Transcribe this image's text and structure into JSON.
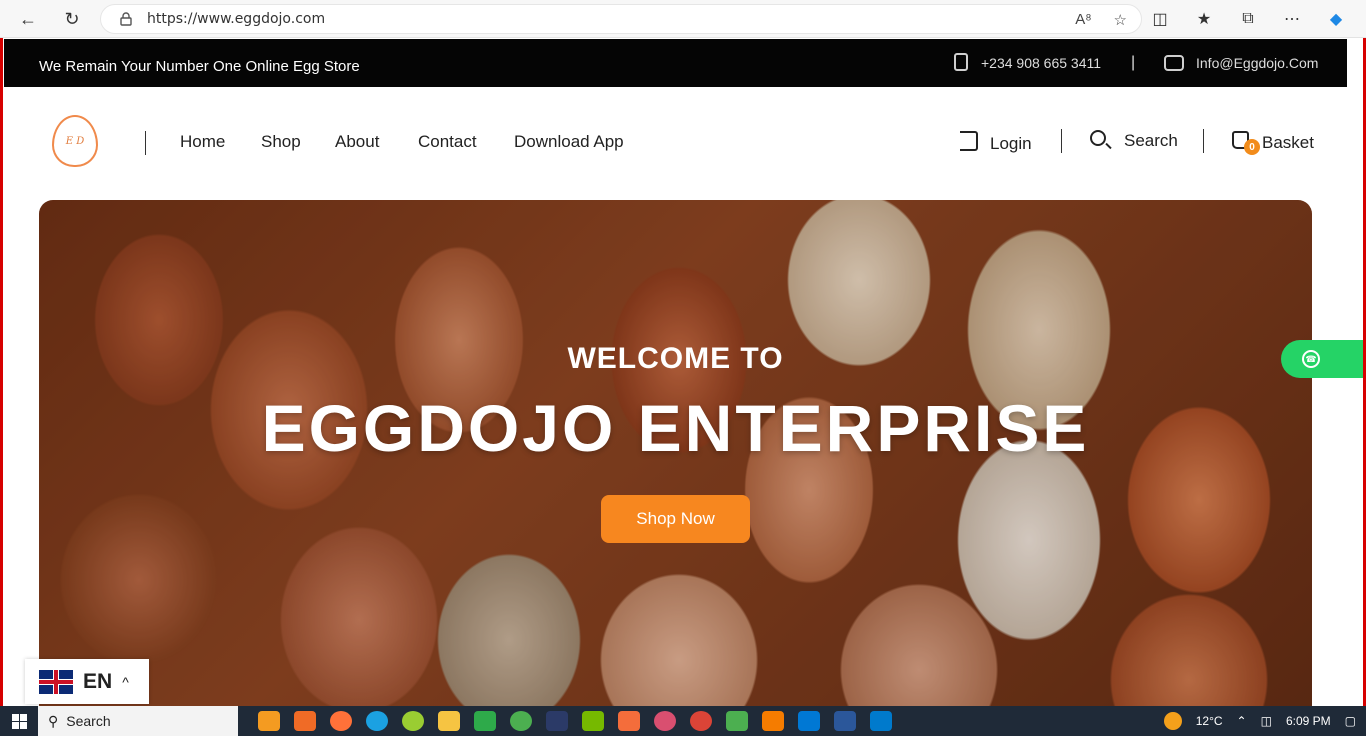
{
  "browser": {
    "url": "https://www.eggdojo.com",
    "icons": [
      "back-icon",
      "refresh-icon",
      "lock-icon",
      "read-aloud-icon",
      "favorite-icon",
      "split-screen-icon",
      "favorites-icon",
      "collections-icon",
      "more-icon",
      "copilot-icon"
    ]
  },
  "topbar": {
    "tagline": "We Remain Your Number One Online Egg Store",
    "phone": "+234 908 665 3411",
    "separator": "|",
    "email": "Info@Eggdojo.Com"
  },
  "logo": {
    "text": "E D"
  },
  "nav": {
    "items": [
      {
        "label": "Home"
      },
      {
        "label": "Shop"
      },
      {
        "label": "About"
      },
      {
        "label": "Contact"
      },
      {
        "label": "Download App"
      }
    ]
  },
  "actions": {
    "login": "Login",
    "search": "Search",
    "basket": "Basket",
    "basket_count": "0"
  },
  "hero": {
    "welcome": "WELCOME TO",
    "brand": "EGGDOJO ENTERPRISE",
    "cta": "Shop Now"
  },
  "language": {
    "code": "EN",
    "caret": "^"
  },
  "taskbar": {
    "search_label": "Search",
    "temperature": "12°C",
    "time": "6:09 PM"
  },
  "colors": {
    "accent": "#f7871f",
    "topbar": "#050505",
    "whatsapp": "#25d366"
  }
}
